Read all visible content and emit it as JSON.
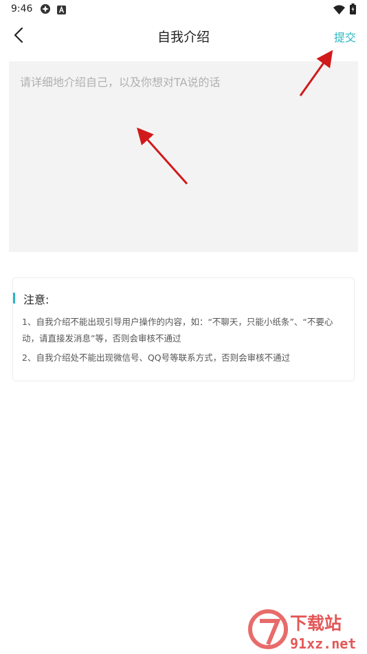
{
  "status_bar": {
    "time": "9:46"
  },
  "header": {
    "title": "自我介绍",
    "submit_label": "提交"
  },
  "intro": {
    "placeholder": "请详细地介绍自己，以及你想对TA说的话",
    "value": ""
  },
  "notice": {
    "title": "注意:",
    "items": [
      "1、自我介绍不能出现引导用户操作的内容，如：“不聊天，只能小纸条”、“不要心动，请直接发消息”等，否则会审核不通过",
      "2、自我介绍处不能出现微信号、QQ号等联系方式，否则会审核不通过"
    ]
  },
  "colors": {
    "accent": "#2ab7c2",
    "arrow": "#d11a1a",
    "input_bg": "#f3f3f3"
  },
  "watermark": {
    "brand": "下载站",
    "site": "91xz.net"
  }
}
